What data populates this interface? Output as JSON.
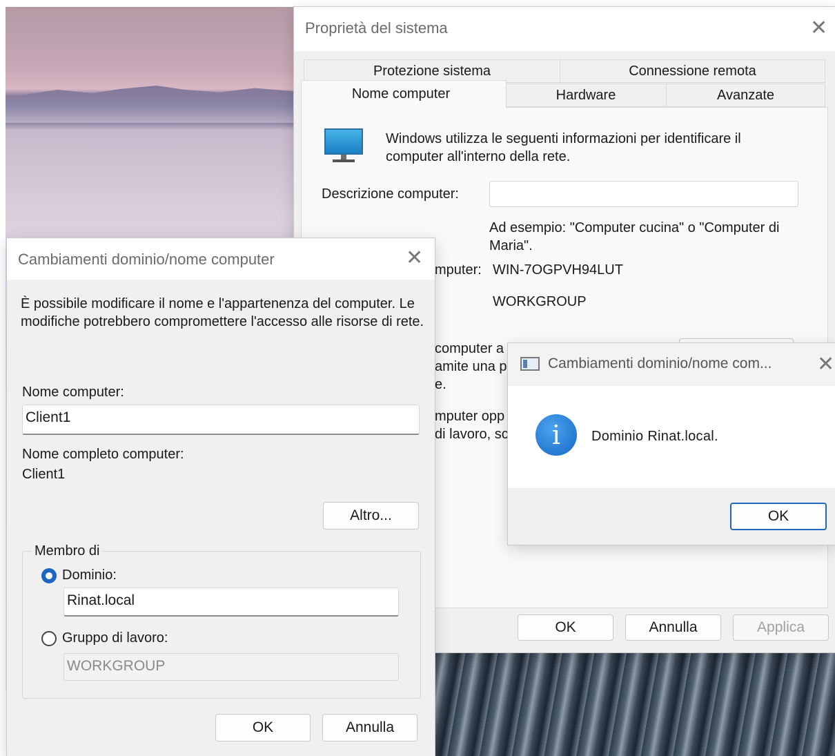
{
  "system_properties": {
    "title": "Proprietà del sistema",
    "tabs_row1": [
      "Protezione sistema",
      "Connessione remota"
    ],
    "tabs_row2": [
      "Nome computer",
      "Hardware",
      "Avanzate"
    ],
    "active_tab": "Nome computer",
    "intro_text": "Windows utilizza le seguenti informazioni per identificare il computer all'interno della rete.",
    "description_label": "Descrizione computer:",
    "description_value": "",
    "example_text": "Ad esempio: \"Computer cucina\" o \"Computer di Maria\".",
    "full_name_label_partial": "mputer:",
    "full_name_value": "WIN-7OGPVH94LUT",
    "workgroup_value": "WORKGROUP",
    "partial_text_1": "computer a u",
    "partial_text_2": "amite una pi",
    "partial_text_3": "e.",
    "partial_text_4": "mputer opp",
    "partial_text_5": "di lavoro, sc",
    "buttons": {
      "ok": "OK",
      "cancel": "Annulla",
      "apply": "Applica"
    }
  },
  "domain_dialog": {
    "title": "Cambiamenti dominio/nome computer",
    "intro_text": "È possibile modificare il nome e l'appartenenza del computer. Le modifiche potrebbero compromettere l'accesso alle risorse di rete.",
    "computer_name_label": "Nome computer:",
    "computer_name_value": "Client1",
    "full_name_label": "Nome completo computer:",
    "full_name_value": "Client1",
    "more_button": "Altro...",
    "member_of_label": "Membro di",
    "domain_label": "Dominio:",
    "domain_value": "Rinat.local",
    "domain_selected": true,
    "workgroup_label": "Gruppo di lavoro:",
    "workgroup_value": "WORKGROUP",
    "buttons": {
      "ok": "OK",
      "cancel": "Annulla"
    }
  },
  "message_box": {
    "title": "Cambiamenti dominio/nome com...",
    "message": "Dominio Rinat.local.",
    "icon": "info-icon",
    "ok_button": "OK"
  }
}
